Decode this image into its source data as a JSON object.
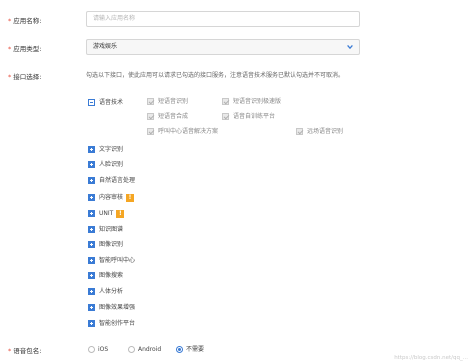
{
  "form": {
    "app_name": {
      "label": "应用名称:",
      "placeholder": "请输入应用名称"
    },
    "app_type": {
      "label": "应用类型:",
      "value": "游戏娱乐"
    },
    "interface": {
      "label": "接口选择:",
      "hint": "勾选以下接口，使此应用可以请求已勾选的接口服务，注意语音技术服务已默认勾选并不可取消。",
      "categories": [
        {
          "label": "语音技术",
          "expanded": true,
          "items": [
            "短语音识别",
            "短语音识别极速版",
            "短语音合成",
            "语音自训练平台",
            "呼叫中心语音解决方案",
            "远场语音识别"
          ]
        },
        {
          "label": "文字识别"
        },
        {
          "label": "人脸识别"
        },
        {
          "label": "自然语言处理"
        },
        {
          "label": "内容审核",
          "warning": "!"
        },
        {
          "label": "UNIT",
          "warning": "!"
        },
        {
          "label": "知识图谱"
        },
        {
          "label": "图像识别"
        },
        {
          "label": "智能呼叫中心"
        },
        {
          "label": "图像搜索"
        },
        {
          "label": "人体分析"
        },
        {
          "label": "图像效果增强"
        },
        {
          "label": "智能创作平台"
        }
      ]
    },
    "package": {
      "label": "语音包名:",
      "options": [
        "iOS",
        "Android",
        "不需要"
      ],
      "selected": "不需要"
    }
  },
  "colors": {
    "required": "#e74c3c",
    "accent": "#3a7bd5",
    "warning": "#f5a623"
  },
  "watermark": "https://blog.csdn.net/qq_..."
}
